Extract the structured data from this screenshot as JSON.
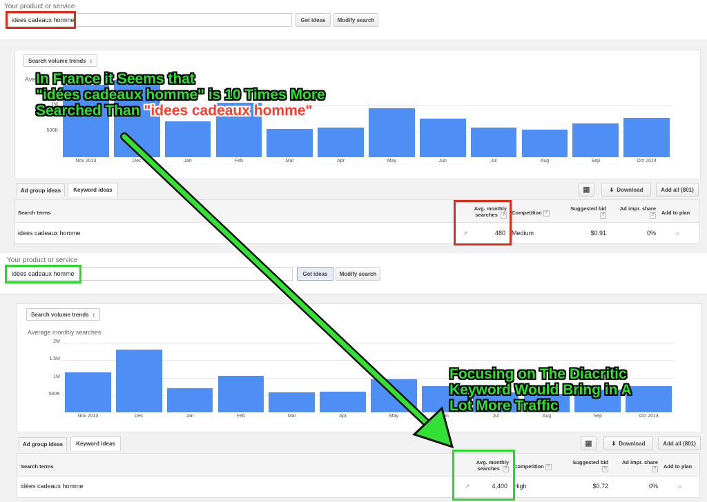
{
  "top": {
    "service_label": "Your product or service",
    "search_value": "idees cadeaux homme",
    "get_ideas": "Get ideas",
    "modify_search": "Modify search",
    "trend_dropdown": "Search volume trends",
    "chart_title_partial": "Ave",
    "tabs": [
      "Ad group ideas",
      "Keyword ideas"
    ],
    "download": "Download",
    "add_all": "Add all (801)",
    "table_headers": {
      "search_terms": "Search terms",
      "avg_monthly": "Avg. monthly searches",
      "competition": "Competition",
      "suggested_bid": "Suggested bid",
      "ad_impr": "Ad impr. share",
      "add_to_plan": "Add to plan"
    },
    "row": {
      "term": "idees cadeaux homme",
      "avg": "480",
      "competition": "Medium",
      "bid": "$0.91",
      "impr": "0%",
      "add": "»"
    }
  },
  "bottom": {
    "service_label": "Your product or service",
    "search_value": "idées cadeaux homme",
    "get_ideas": "Get ideas",
    "modify_search": "Modify search",
    "trend_dropdown": "Search volume trends",
    "chart_title": "Average monthly searches",
    "tabs": [
      "Ad group ideas",
      "Keyword ideas"
    ],
    "download": "Download",
    "add_all": "Add all (801)",
    "table_headers": {
      "search_terms": "Search terms",
      "avg_monthly": "Avg. monthly searches",
      "competition": "Competition",
      "suggested_bid": "Suggested bid",
      "ad_impr": "Ad impr. share",
      "add_to_plan": "Add to plan"
    },
    "row": {
      "term": "idées cadeaux homme",
      "avg": "4,400",
      "competition": "High",
      "bid": "$0.72",
      "impr": "0%",
      "add": "»"
    }
  },
  "annotations": {
    "top_line1": "In France it Seems that",
    "top_line2": "\"idées cadeaux homme\" is 10 Times More",
    "top_line3_a": "Searched Than ",
    "top_line3_b": "\"idees cadeaux homme\"",
    "bottom_line1": "Focusing on The Diacritic",
    "bottom_line2": "Keyword Would Bring in A",
    "bottom_line3": "Lot More Traffic"
  },
  "colors": {
    "bar": "#4d8ff5",
    "red_box": "#e32b1b",
    "green_box": "#2fd52f",
    "annotation": "#2ee02e"
  },
  "chart_data": [
    {
      "type": "bar",
      "categories": [
        "Nov 2013",
        "Dec",
        "Jan",
        "Feb",
        "Mar",
        "Apr",
        "May",
        "Jun",
        "Jul",
        "Aug",
        "Sep",
        "Oct 2014"
      ],
      "yticks": [
        "1M",
        "500K"
      ],
      "ylim": [
        0,
        1600000
      ],
      "values": [
        1400000,
        1500000,
        700000,
        1050000,
        550000,
        580000,
        950000,
        750000,
        580000,
        530000,
        650000,
        760000
      ]
    },
    {
      "type": "bar",
      "title": "Average monthly searches",
      "categories": [
        "Nov 2013",
        "Dec",
        "Jan",
        "Feb",
        "Mar",
        "Apr",
        "May",
        "Jun",
        "Jul",
        "Aug",
        "Sep",
        "Oct 2014"
      ],
      "yticks": [
        "2M",
        "1.5M",
        "1M",
        "500K"
      ],
      "ylim": [
        0,
        2000000
      ],
      "values": [
        1150000,
        1800000,
        700000,
        1050000,
        570000,
        590000,
        950000,
        750000,
        580000,
        530000,
        650000,
        760000
      ]
    }
  ]
}
